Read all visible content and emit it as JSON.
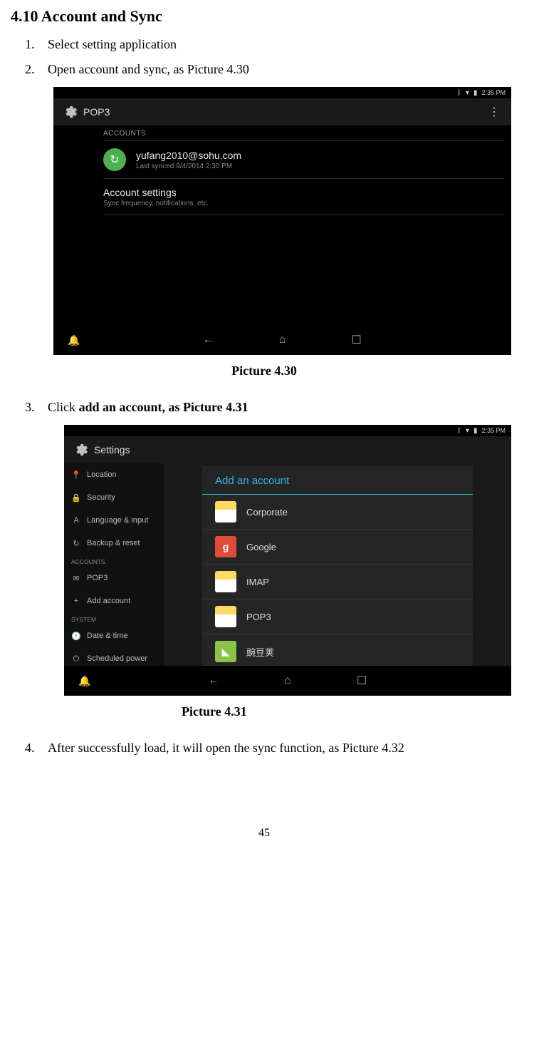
{
  "heading": "4.10 Account and Sync",
  "steps": {
    "s1_num": "1.",
    "s1": "Select setting application",
    "s2_num": "2.",
    "s2": "Open account and sync, as Picture 4.30",
    "s3_num": "3.",
    "s3_pre": "Click ",
    "s3_bold": "add an account, as Picture 4.31",
    "s4_num": "4.",
    "s4": "After successfully load, it will open the sync function, as Picture 4.32"
  },
  "caption1": "Picture 4.30",
  "caption2": "Picture 4.31",
  "page_number": "45",
  "shot1": {
    "time": "2:35 PM",
    "title": "POP3",
    "accounts_label": "ACCOUNTS",
    "account_email": "yufang2010@sohu.com",
    "account_sub": "Last synced 9/4/2014 2:30 PM",
    "account_settings": "Account settings",
    "account_settings_sub": "Sync frequency, notifications, etc."
  },
  "shot2": {
    "time": "2:35 PM",
    "title": "Settings",
    "sidebar": {
      "location": "Location",
      "security": "Security",
      "lang": "Language & input",
      "backup": "Backup & reset",
      "accounts_label": "ACCOUNTS",
      "pop3": "POP3",
      "add_account": "Add account",
      "system_label": "SYSTEM",
      "datetime": "Date & time",
      "scheduled": "Scheduled power"
    },
    "modal": {
      "title": "Add an account",
      "corporate": "Corporate",
      "google": "Google",
      "imap": "IMAP",
      "pop3": "POP3",
      "wandoujia": "豌豆荚"
    }
  }
}
